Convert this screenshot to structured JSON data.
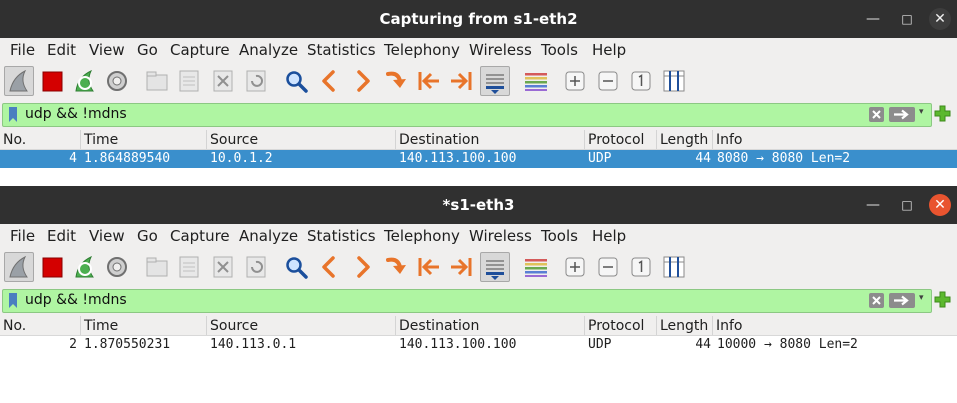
{
  "menu_labels": [
    "File",
    "Edit",
    "View",
    "Go",
    "Capture",
    "Analyze",
    "Statistics",
    "Telephony",
    "Wireless",
    "Tools",
    "Help"
  ],
  "icons": {
    "minimize": "—",
    "maximize": "□",
    "close": "✕",
    "dropdown": "▾"
  },
  "colors": {
    "titlebar": "#303030",
    "filter_bg": "#aff5a2",
    "selected_row": "#3a8fcc",
    "close_active": "#e9542f"
  },
  "columns": [
    "No.",
    "Time",
    "Source",
    "Destination",
    "Protocol",
    "Length",
    "Info"
  ],
  "windows": [
    {
      "title": "Capturing from s1-eth2",
      "filter": "udp && !mdns",
      "packet": {
        "no": "4",
        "time": "1.864889540",
        "source": "10.0.1.2",
        "destination": "140.113.100.100",
        "protocol": "UDP",
        "length": "44",
        "info": "8080 → 8080 Len=2"
      }
    },
    {
      "title": "*s1-eth3",
      "filter": "udp && !mdns",
      "packet": {
        "no": "2",
        "time": "1.870550231",
        "source": "140.113.0.1",
        "destination": "140.113.100.100",
        "protocol": "UDP",
        "length": "44",
        "info": "10000 → 8080 Len=2"
      }
    }
  ]
}
